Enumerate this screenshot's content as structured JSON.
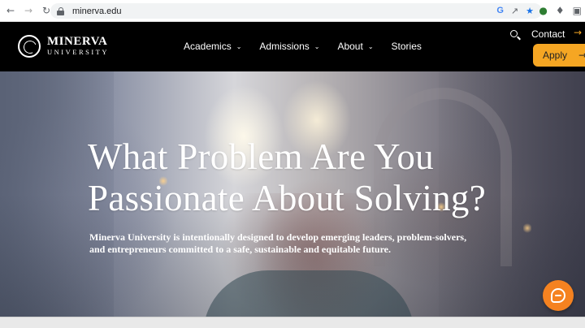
{
  "browser": {
    "url": "minerva.edu",
    "nav_icons": [
      "back-arrow-icon",
      "forward-arrow-icon",
      "reload-icon"
    ],
    "omnibox_icons": [
      "google-icon",
      "share-icon",
      "star-icon"
    ],
    "extension_icons": [
      "extension-frog-icon",
      "puzzle-icon",
      "side-panel-icon"
    ]
  },
  "site": {
    "logo": {
      "name": "MINERVA",
      "sub": "UNIVERSITY"
    },
    "nav": [
      {
        "label": "Academics",
        "has_dropdown": true
      },
      {
        "label": "Admissions",
        "has_dropdown": true
      },
      {
        "label": "About",
        "has_dropdown": true
      },
      {
        "label": "Stories",
        "has_dropdown": false
      }
    ],
    "contact_label": "Contact",
    "apply_label": "Apply",
    "accent_color": "#f5a623"
  },
  "hero": {
    "headline_line1": "What Problem Are You",
    "headline_line2": "Passionate About Solving?",
    "subtext": "Minerva University is intentionally designed to develop emerging leaders, problem-solvers, and entrepreneurs committed to a safe, sustainable and equitable future."
  },
  "chat": {
    "color": "#f58220",
    "icon": "chat-bubble-icon"
  }
}
